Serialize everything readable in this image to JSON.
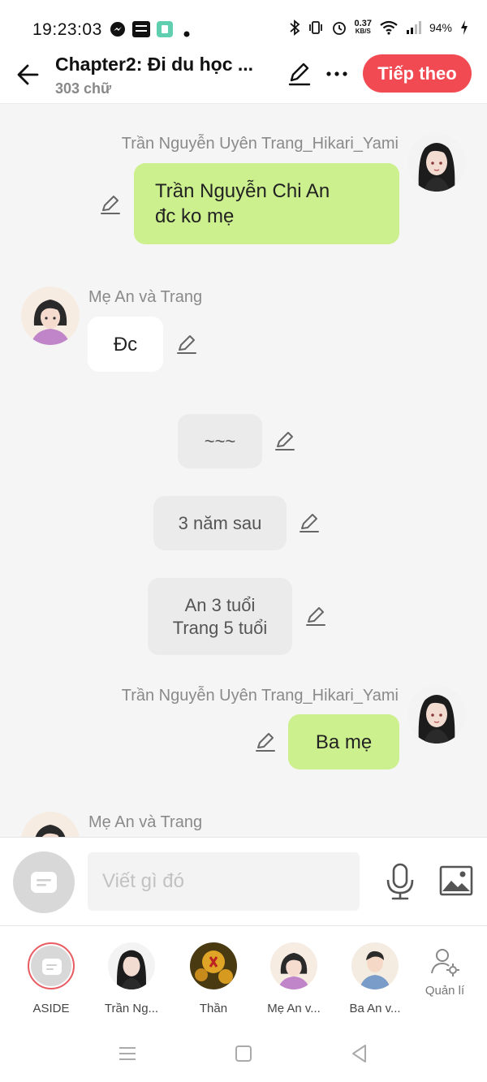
{
  "status_bar": {
    "time": "19:23:03",
    "speed_value": "0.37",
    "speed_unit": "KB/S",
    "battery": "94%"
  },
  "header": {
    "title": "Chapter2: Đi du học ...",
    "word_count": "303 chữ",
    "next_label": "Tiếp theo"
  },
  "messages": [
    {
      "sender": "Trần Nguyễn Uyên Trang_Hikari_Yami",
      "text": "Trần Nguyễn Chi An\nđc ko mẹ"
    },
    {
      "sender": "Mẹ An và Trang",
      "text": "Đc"
    },
    {
      "text": "~~~"
    },
    {
      "text": "3 năm sau"
    },
    {
      "text": "An 3 tuổi\nTrang 5 tuổi"
    },
    {
      "sender": "Trần Nguyễn Uyên Trang_Hikari_Yami",
      "text": "Ba mẹ"
    },
    {
      "sender": "Mẹ An và Trang"
    }
  ],
  "input": {
    "placeholder": "Viết gì đó"
  },
  "characters": [
    {
      "label": "ASIDE"
    },
    {
      "label": "Trần Ng..."
    },
    {
      "label": "Thần"
    },
    {
      "label": "Mẹ An v..."
    },
    {
      "label": "Ba An v..."
    },
    {
      "label": "Quản lí"
    }
  ],
  "colors": {
    "accent": "#f14a52",
    "user_bubble": "#cdf08e",
    "narration_bubble": "#ebebeb",
    "background": "#f5f5f5"
  },
  "icons": [
    "messenger-icon",
    "baomoi-icon",
    "app-icon",
    "bluetooth-icon",
    "vibrate-icon",
    "alarm-icon",
    "wifi-icon",
    "signal-icon",
    "battery-icon",
    "back-arrow-icon",
    "pencil-icon",
    "more-icon",
    "mic-icon",
    "image-icon",
    "manage-icon",
    "menu-icon",
    "home-icon",
    "back-triangle-icon"
  ]
}
